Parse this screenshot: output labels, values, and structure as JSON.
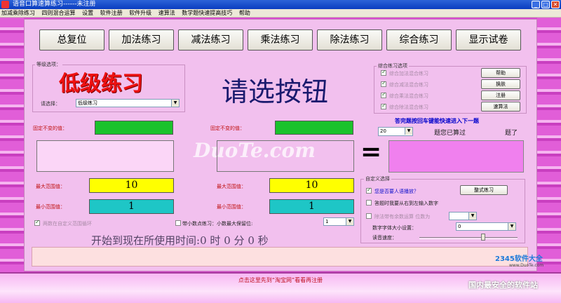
{
  "window": {
    "title": "语音口算速算练习------未注册"
  },
  "menu": [
    "加减乘除练习",
    "四则混合运算",
    "设置",
    "软件注册",
    "软件升级",
    "速算法",
    "数学题快速提高技巧",
    "帮助"
  ],
  "toolbar": [
    "总复位",
    "加法练习",
    "减法练习",
    "乘法练习",
    "除法练习",
    "综合练习",
    "显示试卷"
  ],
  "level": {
    "group_label": "等级选项：",
    "banner": "低级练习",
    "select_label": "请选择：",
    "select_value": "低级练习"
  },
  "prompt": "请选按钮",
  "combo_practice": {
    "group_label": "综合练习选项",
    "options": [
      {
        "label": "综合加法混合练习",
        "checked": true
      },
      {
        "label": "综合减法混合练习",
        "checked": true
      },
      {
        "label": "综合乘法混合练习",
        "checked": true
      },
      {
        "label": "综合除法混合练习",
        "checked": true
      }
    ],
    "buttons": [
      "帮助",
      "换肤",
      "注册",
      "速算法"
    ]
  },
  "left_operand": {
    "fixed_label": "固定不变的值：",
    "max_label": "最大范围值：",
    "max_value": "10",
    "min_label": "最小范围值：",
    "min_value": "1",
    "random_label": "两数在自定义范围循环"
  },
  "right_operand": {
    "fixed_label": "固定不变的值：",
    "max_label": "最大范围值：",
    "max_value": "10",
    "min_label": "最小范围值：",
    "min_value": "1"
  },
  "decimal": {
    "label": "带小数点练习：小数最大保留位:",
    "value": "1"
  },
  "equals_sign": "=",
  "progress": {
    "hint": "答完题按回车键能快速进入下一题",
    "count_value": "20",
    "answered_text": "题您已算过",
    "unit": "题了"
  },
  "custom": {
    "group_label": "自定义选择",
    "voice_label": "您是否要人语播放？",
    "voice_checked": true,
    "rtl_label": "答题时我要从右到左输入数字",
    "rtl_checked": false,
    "remainder_label": "除法带有余数运算  位数为",
    "remainder_checked": false,
    "practice_button": "整式练习",
    "font_label": "数字字体大小设置：",
    "font_value": "0",
    "speed_label": "读音速度："
  },
  "timer": {
    "prefix": "开始到现在所使用时间:",
    "hours": "0",
    "h_unit": "时",
    "minutes": "0",
    "m_unit": "分",
    "seconds": "0",
    "s_unit": "秒"
  },
  "footer_link": "点击这里先到“淘宝网”看看再注册",
  "watermark": "DuoTe.com",
  "brand": {
    "name": "2345软件大全",
    "sub": "www.DuoTe.com",
    "slogan": "国内最安全的软件站"
  },
  "colors": {
    "frame": "#d94ad0",
    "panel": "#f2c0ee",
    "accent_red": "#ee1111",
    "green": "#1ac22c",
    "yellow": "#ffff00",
    "teal": "#1ec6c6",
    "magenta": "#f080ee"
  }
}
